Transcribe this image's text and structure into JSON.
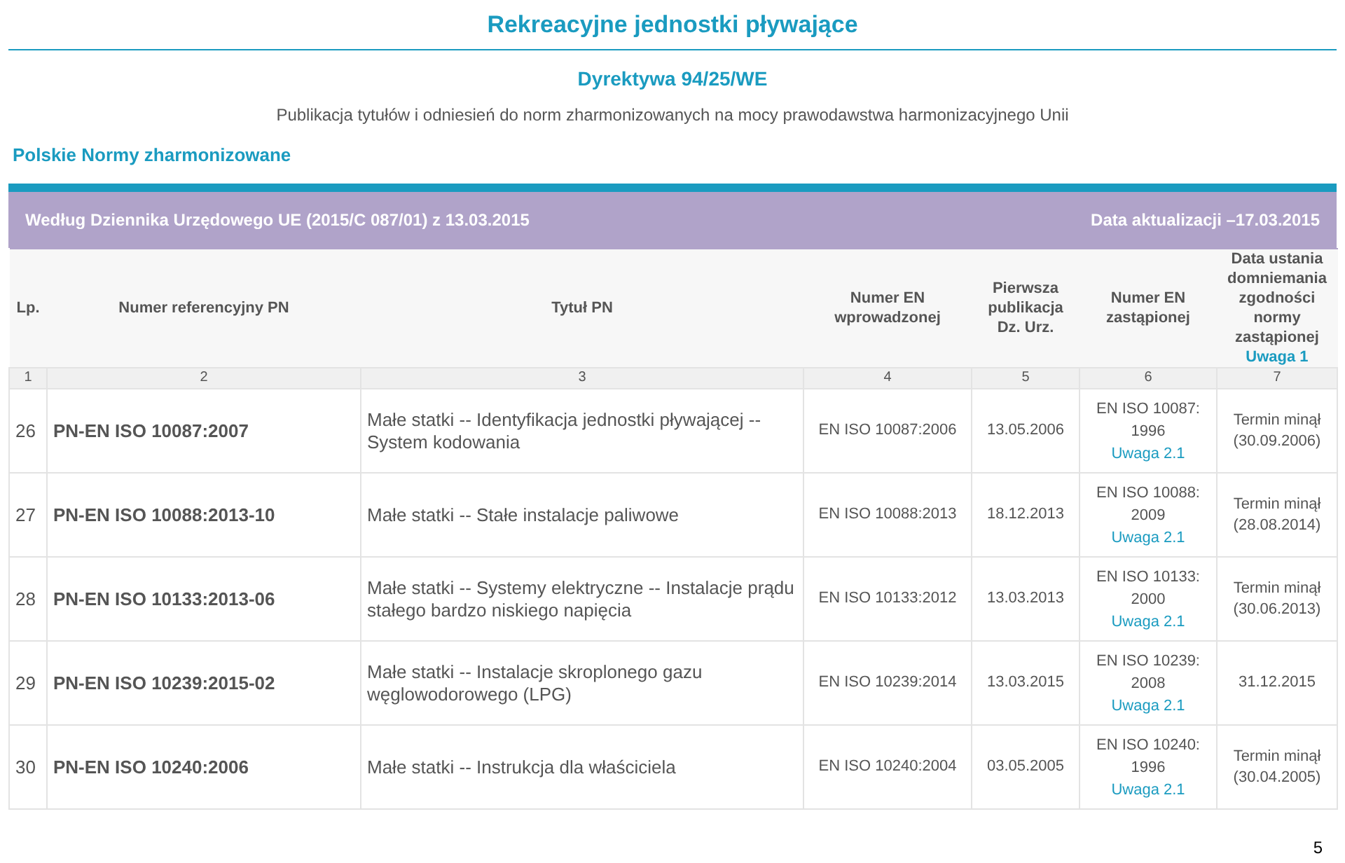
{
  "title": "Rekreacyjne jednostki pływające",
  "directive": "Dyrektywa 94/25/WE",
  "subtitle": "Publikacja tytułów i odniesień do norm zharmonizowanych na mocy prawodawstwa harmonizacyjnego Unii",
  "section": "Polskie Normy zharmonizowane",
  "banner": {
    "left": "Według Dziennika Urzędowego UE (2015/C 087/01) z 13.03.2015",
    "right": "Data aktualizacji –17.03.2015"
  },
  "columns": [
    {
      "label": "Lp.",
      "number": "1"
    },
    {
      "label": "Numer referencyjny PN",
      "number": "2"
    },
    {
      "label": "Tytuł PN",
      "number": "3"
    },
    {
      "label": "Numer EN wprowadzonej",
      "number": "4"
    },
    {
      "label": "Pierwsza publikacja Dz. Urz.",
      "number": "5"
    },
    {
      "label": "Numer EN zastąpionej",
      "number": "6"
    },
    {
      "label": "Data ustania domniemania zgodności normy zastąpionej",
      "note": "Uwaga 1",
      "number": "7"
    }
  ],
  "rows": [
    {
      "lp": "26",
      "ref": "PN-EN ISO 10087:2007",
      "title": "Małe statki -- Identyfikacja jednostki pływającej -- System kodowania",
      "en": "EN ISO 10087:2006",
      "published": "13.05.2006",
      "replaced": "EN ISO 10087: 1996",
      "note": "Uwaga 2.1",
      "end": "Termin minął (30.09.2006)"
    },
    {
      "lp": "27",
      "ref": "PN-EN ISO 10088:2013-10",
      "title": "Małe statki -- Stałe instalacje paliwowe",
      "en": "EN ISO 10088:2013",
      "published": "18.12.2013",
      "replaced": "EN ISO 10088: 2009",
      "note": "Uwaga 2.1",
      "end": "Termin minął (28.08.2014)"
    },
    {
      "lp": "28",
      "ref": "PN-EN ISO 10133:2013-06",
      "title": "Małe statki -- Systemy elektryczne -- Instalacje prądu stałego bardzo niskiego napięcia",
      "en": "EN ISO 10133:2012",
      "published": "13.03.2013",
      "replaced": "EN ISO 10133: 2000",
      "note": "Uwaga 2.1",
      "end": "Termin minął (30.06.2013)"
    },
    {
      "lp": "29",
      "ref": "PN-EN ISO 10239:2015-02",
      "title": "Małe statki -- Instalacje skroplonego gazu węglowodorowego (LPG)",
      "en": "EN ISO 10239:2014",
      "published": "13.03.2015",
      "replaced": "EN ISO 10239: 2008",
      "note": "Uwaga 2.1",
      "end": "31.12.2015"
    },
    {
      "lp": "30",
      "ref": "PN-EN ISO 10240:2006",
      "title": "Małe statki -- Instrukcja dla właściciela",
      "en": "EN ISO 10240:2004",
      "published": "03.05.2005",
      "replaced": "EN ISO 10240: 1996",
      "note": "Uwaga 2.1",
      "end": "Termin minął (30.04.2005)"
    }
  ],
  "page_number": "5"
}
